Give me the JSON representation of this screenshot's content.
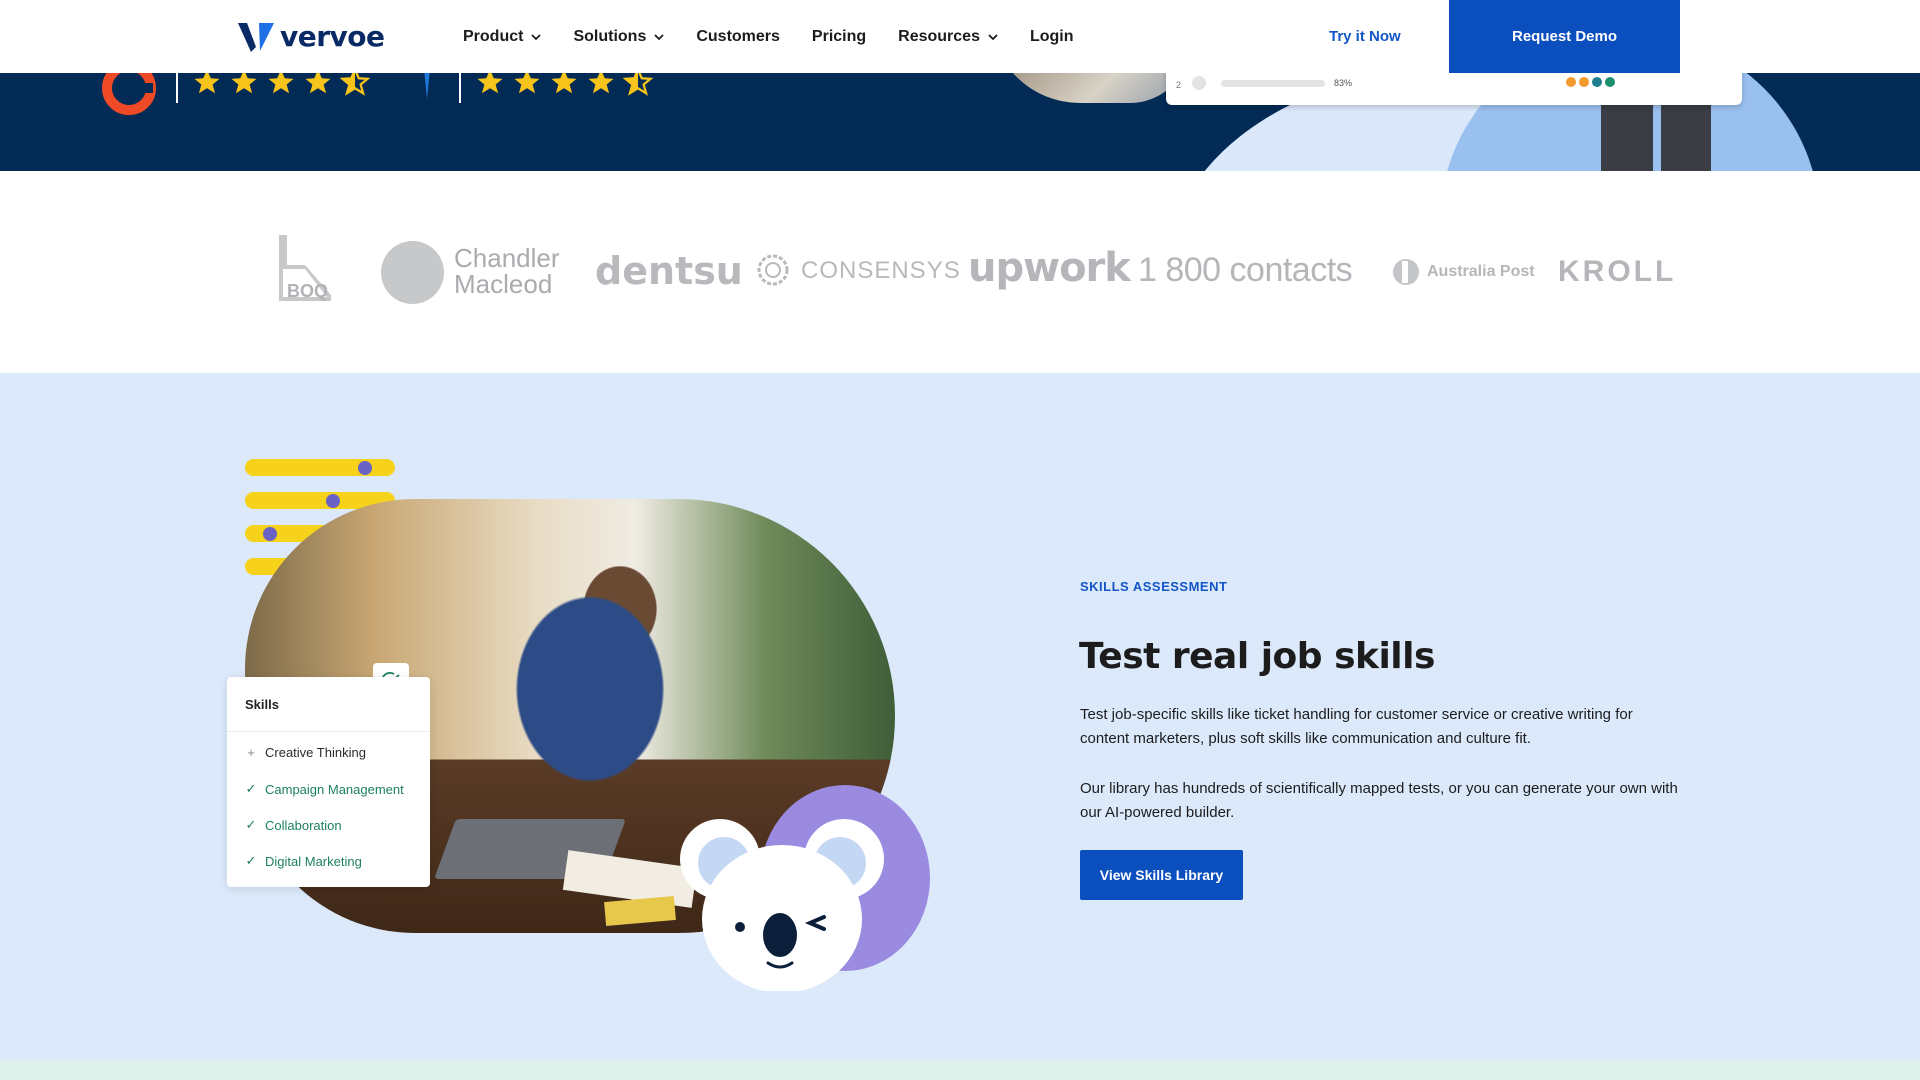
{
  "nav": {
    "logo_text": "vervoe",
    "items": [
      {
        "label": "Product",
        "dropdown": true
      },
      {
        "label": "Solutions",
        "dropdown": true
      },
      {
        "label": "Customers",
        "dropdown": false
      },
      {
        "label": "Pricing",
        "dropdown": false
      },
      {
        "label": "Resources",
        "dropdown": true
      },
      {
        "label": "Login",
        "dropdown": false
      }
    ],
    "try_label": "Try it Now",
    "demo_label": "Request Demo"
  },
  "hero_card": {
    "row_number": "2",
    "percent": "83%"
  },
  "logos": {
    "boq": "BOQ",
    "chandler_line1": "Chandler",
    "chandler_line2": "Macleod",
    "dentsu": "dentsu",
    "consensys": "CONSENSYS",
    "upwork": "upwork",
    "contacts": "1 800 contacts",
    "auspost": "Australia Post",
    "kroll": "KROLL"
  },
  "skills_card": {
    "title": "Skills",
    "items": [
      {
        "label": "Creative Thinking",
        "state": "add"
      },
      {
        "label": "Campaign Management",
        "state": "checked"
      },
      {
        "label": "Collaboration",
        "state": "checked"
      },
      {
        "label": "Digital Marketing",
        "state": "checked"
      }
    ]
  },
  "feature": {
    "eyebrow": "SKILLS ASSESSMENT",
    "headline": "Test real job skills",
    "paragraph1": "Test job-specific skills like ticket handling for customer service or creative writing for content marketers, plus soft skills like communication and culture fit.",
    "paragraph2": "Our library has hundreds of scientifically mapped tests, or you can generate your own with our AI-powered builder.",
    "cta_label": "View Skills Library"
  },
  "colors": {
    "brand_blue": "#0b4fbe",
    "navy": "#032b55",
    "feature_bg": "#dbe9fb",
    "accent_yellow": "#f6d21a",
    "accent_purple": "#9b8be0",
    "check_green": "#1d7f62"
  },
  "icons": [
    "vervoe-logo-icon",
    "chevron-down-icon",
    "g2-logo-icon",
    "star-icon",
    "capterra-logo-icon",
    "check-icon",
    "plus-icon",
    "koala-mascot-icon"
  ]
}
